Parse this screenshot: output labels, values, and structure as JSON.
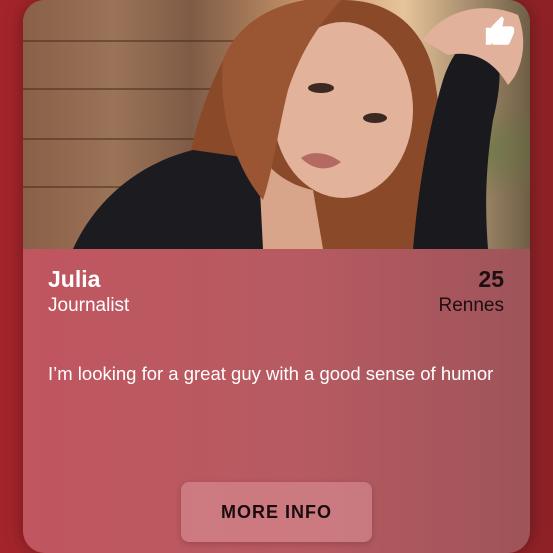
{
  "profile": {
    "name": "Julia",
    "job": "Journalist",
    "age": "25",
    "city": "Rennes",
    "bio": "I’m looking for a great guy with a good sense of humor"
  },
  "actions": {
    "more_info_label": "MORE INFO",
    "like_icon": "thumbs-up-icon"
  },
  "colors": {
    "background": "#a3242a",
    "card": "#b9575f",
    "button": "#d9959a",
    "dark_text": "#1d0f10",
    "light_text": "#ffffff"
  }
}
